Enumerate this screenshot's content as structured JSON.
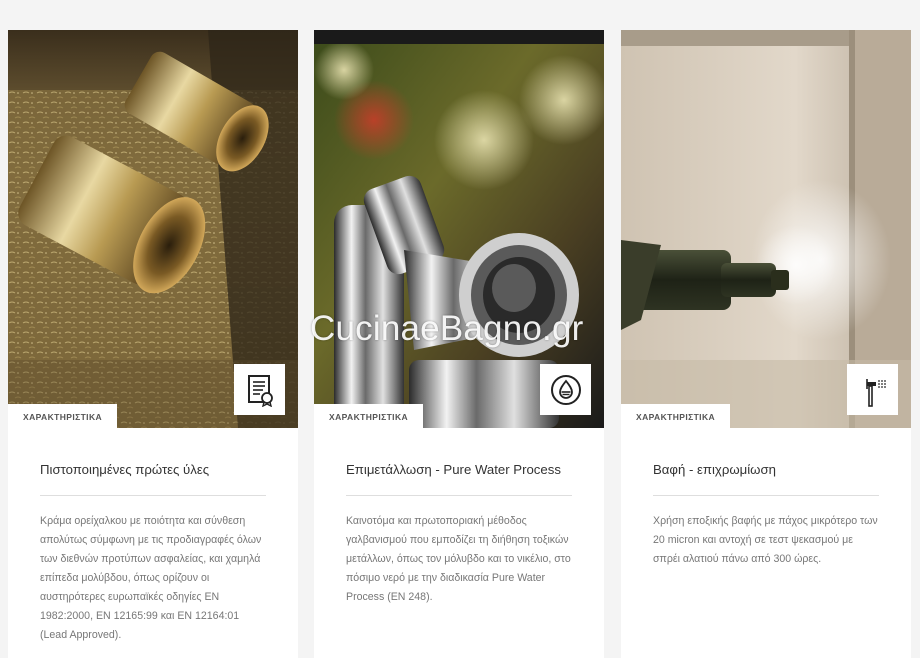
{
  "cards": [
    {
      "tag": "ΧΑΡΑΚΤΗΡΙΣΤΙΚΑ",
      "title": "Πιστοποιημένες πρώτες ύλες",
      "description": "Κράμα ορείχαλκου με ποιότητα και σύνθεση απολύτως σύμφωνη με τις προδιαγραφές όλων των διεθνών προτύπων ασφαλείας, και χαμηλά επίπεδα μολύβδου, όπως ορίζουν οι αυστηρότερες ευρωπαϊκές οδηγίες EN 1982:2000, EN 12165:99 και EN 12164:01 (Lead Approved).",
      "icon": "certificate-icon",
      "image": "brass-parts-photo"
    },
    {
      "tag": "ΧΑΡΑΚΤΗΡΙΣΤΙΚΑ",
      "title": "Επιμετάλλωση - Pure Water Process",
      "description": "Καινοτόμα και πρωτοποριακή μέθοδος γαλβανισμού που εμποδίζει τη διήθηση τοξικών μετάλλων, όπως τον μόλυβδο και το νικέλιο, στο πόσιμο νερό με την διαδικασία Pure Water Process (EN 248).",
      "icon": "water-drop-icon",
      "image": "chrome-fitting-photo"
    },
    {
      "tag": "ΧΑΡΑΚΤΗΡΙΣΤΙΚΑ",
      "title": "Βαφή - επιχρωμίωση",
      "description": "Χρήση εποξικής βαφής με πάχος μικρότερο των 20 micron και αντοχή σε τεστ ψεκασμού με σπρέι αλατιού πάνω από 300 ώρες.",
      "icon": "spray-icon",
      "image": "salt-spray-photo"
    }
  ],
  "watermark": "CucinaeBagno.gr",
  "colors": {
    "page_background": "#f4f4f4",
    "card_background": "#ffffff",
    "rule": "#dedede"
  }
}
